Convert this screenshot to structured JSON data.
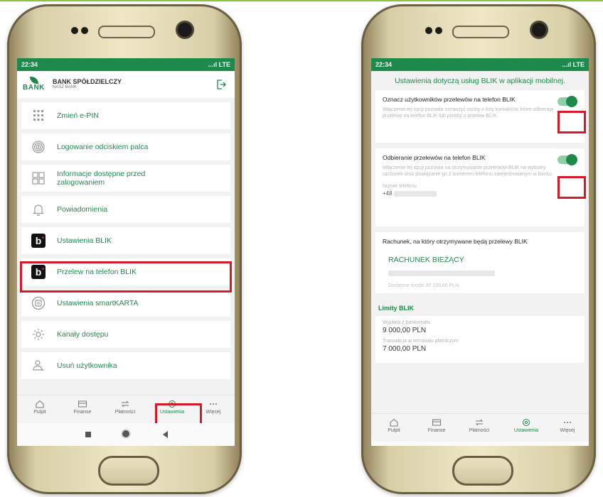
{
  "colors": {
    "brand_green": "#1d8a4b",
    "highlight_red": "#d51b2a",
    "blik_pink": "#e6007e"
  },
  "status": {
    "time": "22:34",
    "signal": "...ıl LTE"
  },
  "bank": {
    "logo_word": "BANK",
    "name": "BANK SPÓŁDZIELCZY",
    "subname": "NASZ BANK"
  },
  "left_menu": [
    {
      "label": "Zmień e-PIN",
      "icon": "keypad-icon"
    },
    {
      "label": "Logowanie odciskiem palca",
      "icon": "fingerprint-icon"
    },
    {
      "label": "Informacje dostępne przed zalogowaniem",
      "icon": "grid-icon"
    },
    {
      "label": "Powiadomienia",
      "icon": "bell-icon"
    },
    {
      "label": "Ustawienia BLIK",
      "icon": "blik-icon"
    },
    {
      "label": "Przelew na telefon BLIK",
      "icon": "blik-icon"
    },
    {
      "label": "Ustawienia smartKARTA",
      "icon": "smartcard-icon"
    },
    {
      "label": "Kanały dostępu",
      "icon": "gear-icon"
    },
    {
      "label": "Usuń użytkownika",
      "icon": "user-remove-icon"
    }
  ],
  "nav": [
    {
      "label": "Pulpit",
      "icon": "home-icon"
    },
    {
      "label": "Finanse",
      "icon": "wallet-icon"
    },
    {
      "label": "Płatności",
      "icon": "transfer-icon"
    },
    {
      "label": "Ustawienia",
      "icon": "settings-icon"
    },
    {
      "label": "Więcej",
      "icon": "more-icon"
    }
  ],
  "right": {
    "title": "Ustawienia dotyczą usług BLIK w aplikacji mobilnej.",
    "toggle1": {
      "label": "Oznacz użytkowników przelewów na telefon BLIK",
      "desc": "Włączenie tej opcji pozwala oznaczyć osoby z listy kontaktów, które odbierają przelewy na telefon BLIK lub prośby o przelew BLIK.",
      "on": true
    },
    "toggle2": {
      "label": "Odbieranie przelewów na telefon BLIK",
      "desc": "Włączenie tej opcji pozwala na otrzymywanie przelewów BLIK na wybrany rachunek oraz powiązanie go z numerem telefonu zarejestrowanym w banku.",
      "phone_label": "Numer telefonu",
      "phone_prefix": "+48",
      "on": true
    },
    "account": {
      "label": "Rachunek, na który otrzymywane będą przelewy BLIK",
      "name": "RACHUNEK BIEŻĄCY",
      "funds": "Dostępne środki 30 159,80 PLN"
    },
    "limits": {
      "title": "Limity BLIK",
      "items": [
        {
          "label": "Wypłata z bankomatu",
          "value": "9 000,00 PLN"
        },
        {
          "label": "Transakcja w terminalu płatniczym",
          "value": "7 000,00 PLN"
        }
      ]
    }
  }
}
